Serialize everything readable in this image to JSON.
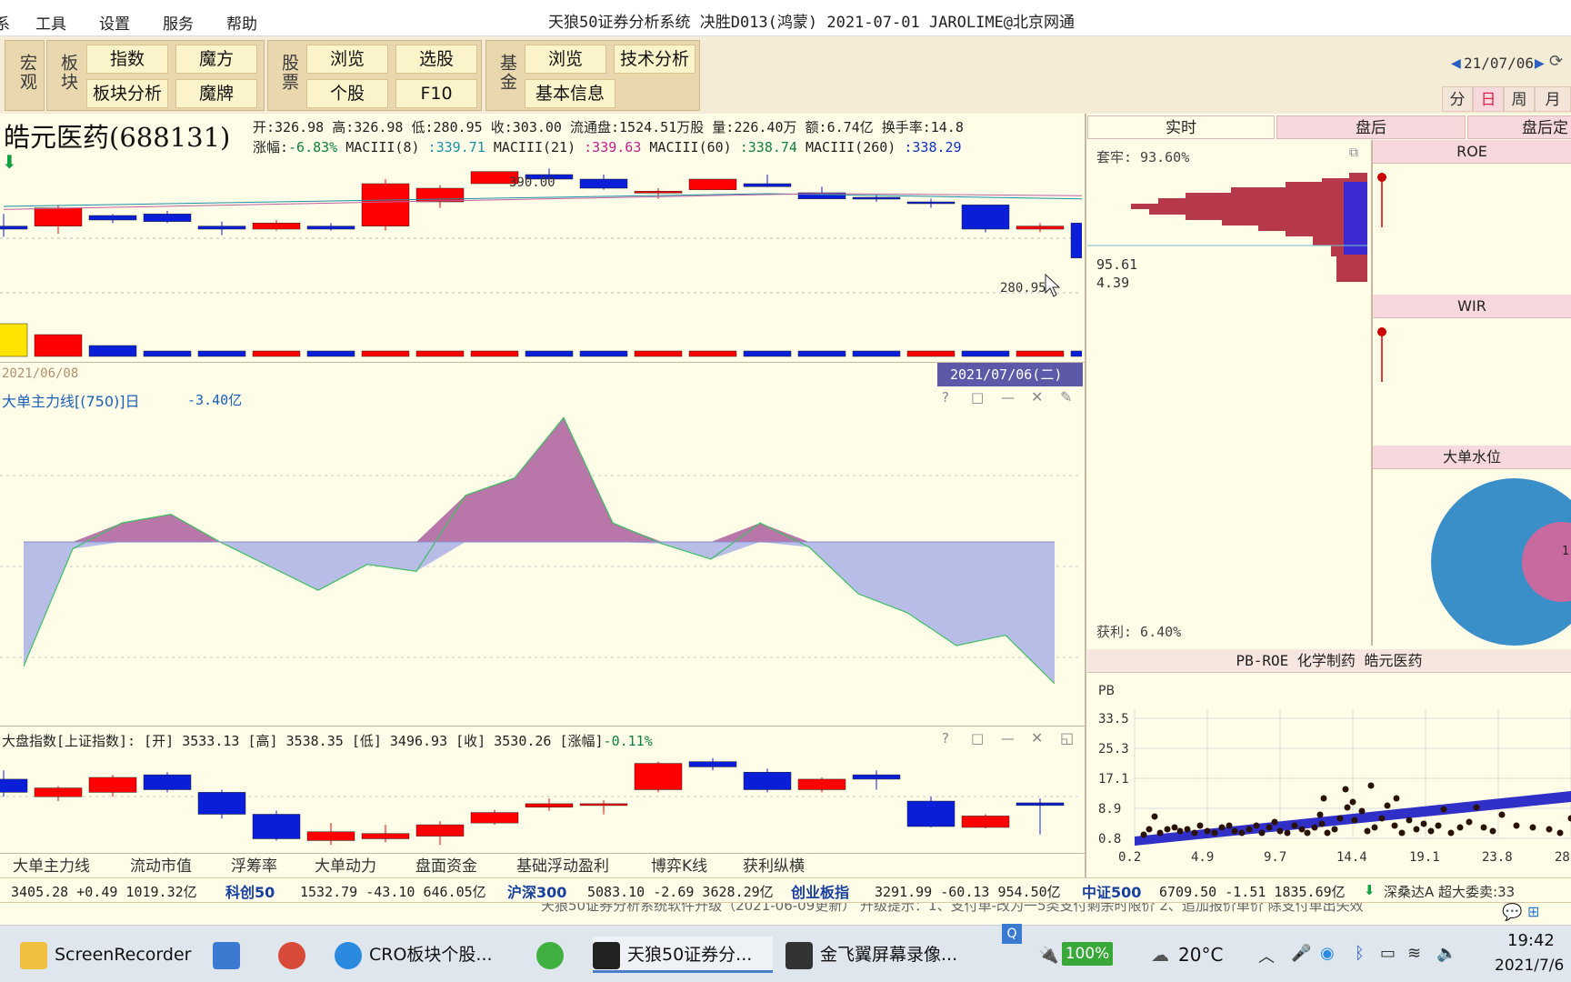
{
  "menu": {
    "cut_left": "系",
    "items": [
      "工具",
      "设置",
      "服务",
      "帮助"
    ],
    "title": "天狼50证券分析系统  决胜D013(鸿蒙)  2021-07-01 JAROLIME@北京网通"
  },
  "toolbar": {
    "groups": {
      "macro": "宏观",
      "sector": "板块",
      "stock": "股票",
      "fund": "基金"
    },
    "buttons": {
      "index": "指数",
      "magic_cube": "魔方",
      "sector_analysis": "板块分析",
      "magic_card": "魔牌",
      "browse": "浏览",
      "pick": "选股",
      "single_stock": "个股",
      "f10": "F10",
      "fund_browse": "浏览",
      "tech_analysis": "技术分析",
      "basic_info": "基本信息"
    },
    "date_nav": "21/07/06",
    "periods": [
      {
        "label": "分",
        "active": false
      },
      {
        "label": "日",
        "active": true
      },
      {
        "label": "周",
        "active": false
      },
      {
        "label": "月",
        "active": false
      }
    ]
  },
  "stock": {
    "name": "皓元医药(688131)",
    "line1": {
      "open_label": "开:",
      "open": "326.98",
      "high_label": "高:",
      "high": "326.98",
      "low_label": "低:",
      "low": "280.95",
      "close_label": "收:",
      "close": "303.00",
      "float_label": "流通盘:",
      "float": "1524.51万股",
      "vol_label": "量:",
      "vol": "226.40万",
      "amt_label": "额:",
      "amt": "6.74亿",
      "turnover_label": "换手率:",
      "turnover": "14.8"
    },
    "line2": {
      "chg_label": "涨幅:",
      "chg": "-6.83%",
      "m8_label": "MACIII(8)",
      "m8": ":339.71",
      "m21_label": "MACIII(21)",
      "m21": ":339.63",
      "m60_label": "MACIII(60)",
      "m60": ":338.74",
      "m260_label": "MACIII(260)",
      "m260": ":338.29"
    },
    "price_high_label": "390.00",
    "price_low_label": "280.95",
    "start_date": "2021/06/08",
    "cursor_date": "2021/07/06(二)"
  },
  "main_line_panel": {
    "title": "大单主力线[(750)]日",
    "value": "-3.40亿"
  },
  "index_panel": {
    "title": "大盘指数[上证指数]:",
    "open_label": "[开]",
    "open": "3533.13",
    "high_label": "[高]",
    "high": "3538.35",
    "low_label": "[低]",
    "low": "3496.93",
    "close_label": "[收]",
    "close": "3530.26",
    "chg_label": "[涨幅]",
    "chg": "-0.11%"
  },
  "right_panel": {
    "tabs": [
      "实时",
      "盘后",
      "盘后定"
    ],
    "trapped": "套牢: 93.60%",
    "price_a": "95.61",
    "price_b": "4.39",
    "profit": "获利: 6.40%",
    "roe_title": "ROE",
    "wir_title": "WIR",
    "water_title": "大单水位",
    "water_value": "1",
    "pbroe_title": "PB-ROE  化学制药  皓元医药",
    "pb_axis": "PB",
    "pb_ticks": [
      "33.5",
      "25.3",
      "17.1",
      "8.9",
      "0.8"
    ],
    "roe_ticks": [
      "0.2",
      "4.9",
      "9.7",
      "14.4",
      "19.1",
      "23.8",
      "28"
    ]
  },
  "bottom_tabs": [
    "大单主力线",
    "流动市值",
    "浮筹率",
    "大单动力",
    "盘面资金",
    "基础浮动盈利",
    "博弈K线",
    "获利纵横"
  ],
  "ticker": {
    "t0": "3405.28  +0.49  1019.32亿",
    "n1": "科创50",
    "t1": "1532.79  -43.10  646.05亿",
    "n2": "沪深300",
    "t2": "5083.10  -2.69  3628.29亿",
    "n3": "创业板指",
    "t3": "3291.99  -60.13  954.50亿",
    "n4": "中证500",
    "t4": "6709.50  -1.51  1835.69亿",
    "t5": "深桑达A  超大委卖:33"
  },
  "notice": "天狼50证券分析系统软件升级（2021-06-09更新）        升级提示：1、支付单-改为一5类支付剩余时限价    2、追加报价单价  除支付单出失效",
  "taskbar": {
    "items": [
      "ScreenRecorder",
      "CRO板块个股...",
      "天狼50证券分...",
      "金飞翼屏幕录像..."
    ],
    "battery": "100%",
    "weather": "20°C",
    "time": "19:42",
    "date": "2021/7/6"
  },
  "colors": {
    "up": "#ff0000",
    "down": "#0a1ed8",
    "bg": "#fffde8",
    "area_pos": "#b877a8",
    "area_neg": "#b8bde8"
  },
  "kline": [
    [
      300,
      310,
      295,
      302,
      0
    ],
    [
      302,
      316,
      297,
      314,
      1
    ],
    [
      306,
      310,
      304,
      309,
      0
    ],
    [
      310,
      312,
      304,
      305,
      0
    ],
    [
      302,
      305,
      296,
      300,
      0
    ],
    [
      300,
      306,
      299,
      304,
      1
    ],
    [
      302,
      304,
      299,
      300,
      0
    ],
    [
      302,
      333,
      299,
      330,
      1
    ],
    [
      318,
      329,
      314,
      327,
      1
    ],
    [
      330,
      338,
      330,
      338,
      1
    ],
    [
      336,
      340,
      332,
      333,
      0
    ],
    [
      333,
      336,
      326,
      327,
      0
    ],
    [
      325,
      327,
      320,
      325,
      1
    ],
    [
      326,
      333,
      326,
      333,
      1
    ],
    [
      330,
      336,
      328,
      328,
      0
    ],
    [
      324,
      328,
      320,
      320,
      0
    ],
    [
      321,
      323,
      318,
      320,
      0
    ],
    [
      318,
      320,
      314,
      318,
      0
    ],
    [
      316,
      316,
      298,
      300,
      0
    ],
    [
      300,
      304,
      298,
      302,
      1
    ],
    [
      304,
      304,
      280,
      281,
      0
    ]
  ],
  "volume": [
    [
      6,
      0
    ],
    [
      4,
      1
    ],
    [
      2,
      0
    ],
    [
      1,
      0
    ],
    [
      1,
      0
    ],
    [
      1,
      1
    ],
    [
      1,
      0
    ],
    [
      1,
      1
    ],
    [
      1,
      1
    ],
    [
      1,
      1
    ],
    [
      1,
      0
    ],
    [
      1,
      0
    ],
    [
      1,
      1
    ],
    [
      1,
      1
    ],
    [
      1,
      0
    ],
    [
      1,
      0
    ],
    [
      1,
      0
    ],
    [
      1,
      1
    ],
    [
      1,
      0
    ],
    [
      1,
      1
    ],
    [
      1,
      0
    ]
  ],
  "main_line": [
    -3.6,
    -0.2,
    0.55,
    0.8,
    0.0,
    -0.7,
    -1.4,
    -0.65,
    -0.85,
    1.35,
    1.85,
    3.6,
    0.55,
    -0.05,
    -0.5,
    0.55,
    -0.15,
    -1.5,
    -2.05,
    -3.0,
    -2.7,
    -4.1
  ],
  "index_kline": [
    [
      3560,
      3570,
      3540,
      3545,
      0
    ],
    [
      3540,
      3552,
      3535,
      3550,
      1
    ],
    [
      3545,
      3565,
      3540,
      3562,
      1
    ],
    [
      3565,
      3568,
      3545,
      3548,
      0
    ],
    [
      3545,
      3548,
      3515,
      3520,
      0
    ],
    [
      3520,
      3524,
      3490,
      3492,
      0
    ],
    [
      3490,
      3510,
      3485,
      3500,
      1
    ],
    [
      3492,
      3508,
      3488,
      3498,
      1
    ],
    [
      3495,
      3512,
      3485,
      3508,
      1
    ],
    [
      3510,
      3525,
      3508,
      3522,
      1
    ],
    [
      3528,
      3538,
      3524,
      3532,
      1
    ],
    [
      3530,
      3536,
      3520,
      3532,
      1
    ],
    [
      3548,
      3580,
      3545,
      3578,
      1
    ],
    [
      3580,
      3584,
      3570,
      3574,
      0
    ],
    [
      3568,
      3572,
      3545,
      3548,
      0
    ],
    [
      3548,
      3562,
      3545,
      3560,
      1
    ],
    [
      3565,
      3570,
      3548,
      3560,
      0
    ],
    [
      3535,
      3540,
      3505,
      3506,
      0
    ],
    [
      3505,
      3520,
      3504,
      3518,
      1
    ],
    [
      3533,
      3538,
      3497,
      3530,
      0
    ]
  ]
}
